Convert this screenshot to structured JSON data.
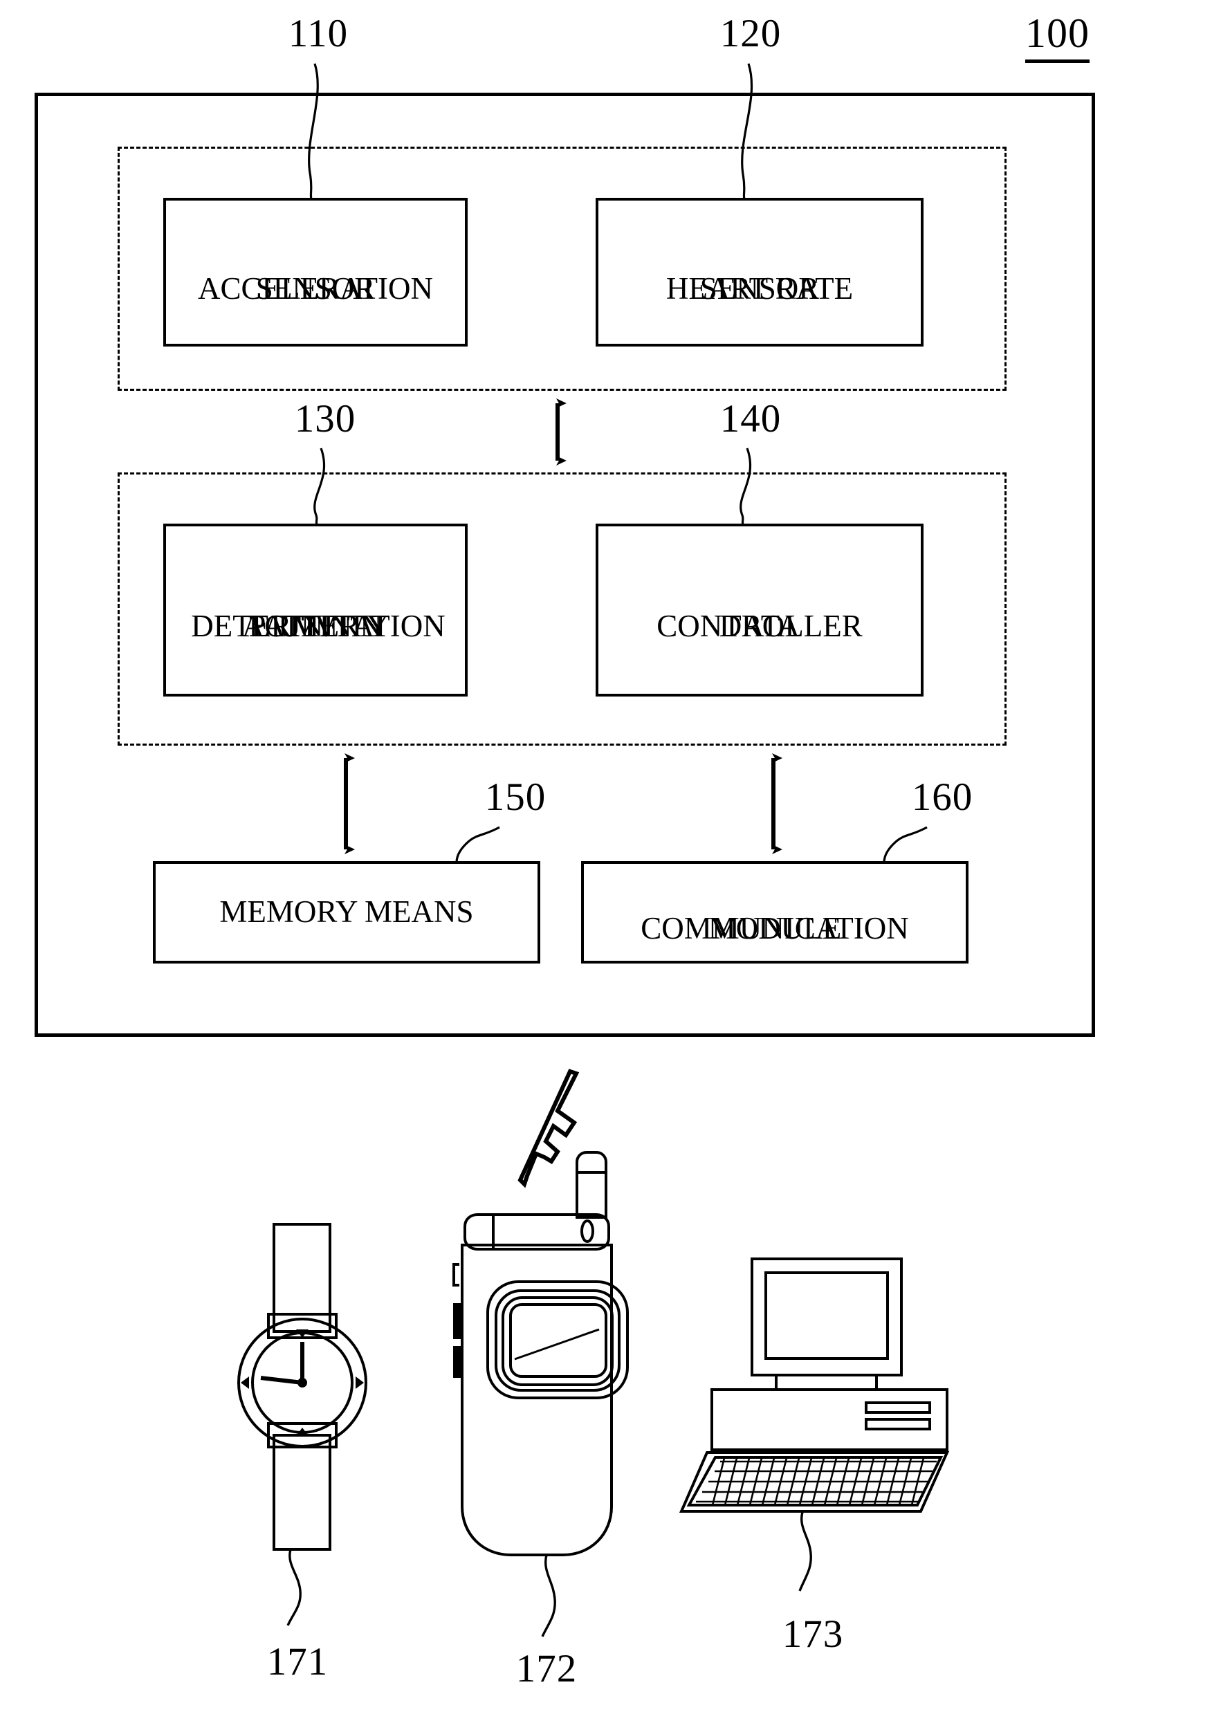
{
  "figure": {
    "system_ref": "100",
    "blocks": [
      {
        "id": "acceleration-sensor",
        "ref": "110",
        "line1": "ACCELERATION",
        "line2": "SENSOR"
      },
      {
        "id": "heart-rate-sensor",
        "ref": "120",
        "line1": "HEART  RATE",
        "line2": "SENSOR"
      },
      {
        "id": "activity-pattern-determination-unit",
        "ref": "130",
        "line1": "ACTIVITY",
        "line2": "PATTERN",
        "line3": "DETERMINATION",
        "line4": "UNIT"
      },
      {
        "id": "data-controller",
        "ref": "140",
        "line1": "DATA",
        "line2": "CONTROLLER"
      },
      {
        "id": "memory-means",
        "ref": "150",
        "line1": "MEMORY  MEANS"
      },
      {
        "id": "communication-module",
        "ref": "160",
        "line1": "COMMUNICATION",
        "line2": "MODULE"
      }
    ],
    "devices": [
      {
        "id": "wrist-watch",
        "ref": "171"
      },
      {
        "id": "mobile-phone",
        "ref": "172"
      },
      {
        "id": "desktop-computer",
        "ref": "173"
      }
    ]
  },
  "colors": {
    "ink": "#000000",
    "paper": "#ffffff"
  }
}
